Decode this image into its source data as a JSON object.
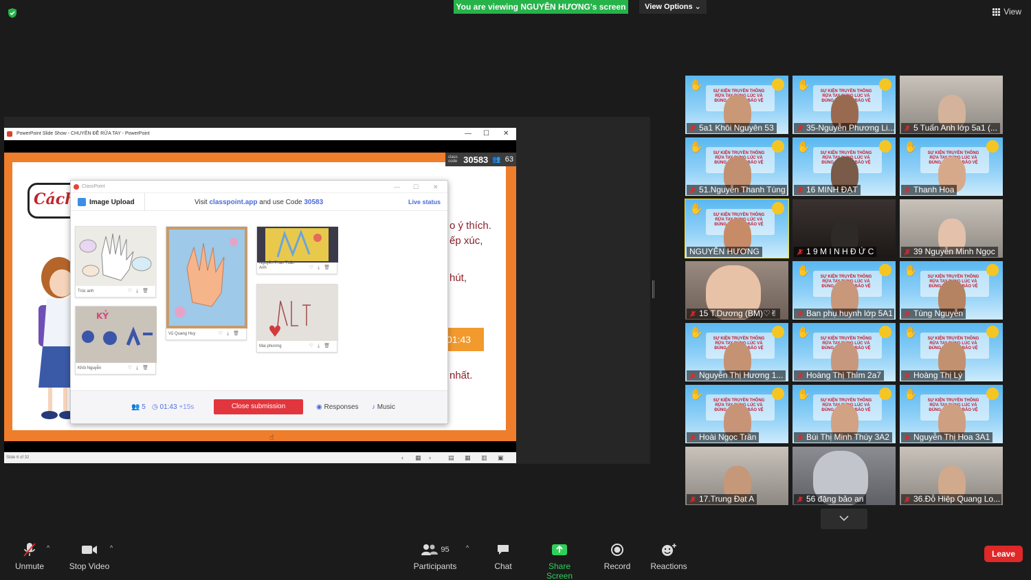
{
  "top": {
    "viewing_banner": "You are viewing NGUYỄN HƯƠNG's screen",
    "view_options": "View Options ⌄",
    "view_label": "View"
  },
  "ppt": {
    "window_title": "PowerPoint Slide Show  -  CHUYÊN ĐỀ RỬA TAY - PowerPoint",
    "status_text": "Slide 6 of 32",
    "slide_title_fragment": "Cách t",
    "slide_text_1": "o ý thích.",
    "slide_text_2": "ếp xúc,",
    "slide_text_3": "hút,",
    "slide_text_4": "nhất.",
    "timer_badge": "01:43",
    "class_code_label": "class code",
    "class_code": "30583",
    "participants_count": "63"
  },
  "classpoint": {
    "title": "ClassPoint",
    "upload_label": "Image Upload",
    "visit_prefix": "Visit ",
    "visit_link": "classpoint.app",
    "visit_mid": " and use Code ",
    "visit_code": "30583",
    "live_status": "Live status",
    "submissions": [
      {
        "name": "Trúc anh"
      },
      {
        "name": "Vũ Quang Huy"
      },
      {
        "name": "Nguyễn Phan Tuấn Anh"
      },
      {
        "name": "Khôi Nguyễn"
      },
      {
        "name": "Mai phương"
      }
    ],
    "count": "5",
    "time": "01:43",
    "time_extra": "+15s",
    "close_button": "Close submission",
    "responses": "Responses",
    "music": "Music"
  },
  "gallery": [
    {
      "name": "5a1 Khôi Nguyên 53",
      "muted": true
    },
    {
      "name": "35-Nguyễn Phương Li...",
      "muted": true
    },
    {
      "name": "5 Tuấn Anh lớp 5a1 (...",
      "muted": true
    },
    {
      "name": "51.Nguyễn Thanh Tùng",
      "muted": true
    },
    {
      "name": "16 MINH ĐẠT",
      "muted": true
    },
    {
      "name": "Thanh Hoa",
      "muted": true
    },
    {
      "name": "NGUYỄN HƯƠNG",
      "muted": false
    },
    {
      "name": "1 9 M I N H Đ Ứ C",
      "muted": true
    },
    {
      "name": "39 Nguyễn Minh Ngọc",
      "muted": true
    },
    {
      "name": "15 T.Dương (BM)♡✌",
      "muted": true
    },
    {
      "name": "Ban phụ huynh lớp 5A1",
      "muted": true
    },
    {
      "name": "Tùng Nguyễn",
      "muted": true
    },
    {
      "name": "Nguyễn Thị Hương 1...",
      "muted": true
    },
    {
      "name": "Hoàng Thị Thìm 2a7",
      "muted": true
    },
    {
      "name": "Hoàng Thị Lý",
      "muted": true
    },
    {
      "name": "Hoài Ngọc Trần",
      "muted": true
    },
    {
      "name": "Bùi Thị Minh Thúy 3A2",
      "muted": true
    },
    {
      "name": "Nguyễn Thị Hoa 3A1",
      "muted": true
    },
    {
      "name": "17.Trung Đạt A",
      "muted": true
    },
    {
      "name": "56 đặng  bảo an",
      "muted": true
    },
    {
      "name": "36.Đỗ Hiệp Quang Lo...",
      "muted": true
    }
  ],
  "banner_text": "SỰ KIỆN TRUYỀN THÔNG RỬA TAY ĐÚNG LÚC VÀ ĐÚNG CÁCH ĐỂ BẢO VỆ SỨC KHỎE",
  "toolbar": {
    "unmute": "Unmute",
    "stop_video": "Stop Video",
    "participants": "Participants",
    "participants_count": "95",
    "chat": "Chat",
    "share_screen": "Share Screen",
    "record": "Record",
    "reactions": "Reactions",
    "leave": "Leave"
  },
  "colors": {
    "banner_green": "#26b34a",
    "share_green": "#2fd05a",
    "leave_red": "#e02828",
    "active_speaker": "#f0e52a",
    "slide_orange": "#ee7d2c",
    "classpoint_blue": "#4a6bdc"
  }
}
